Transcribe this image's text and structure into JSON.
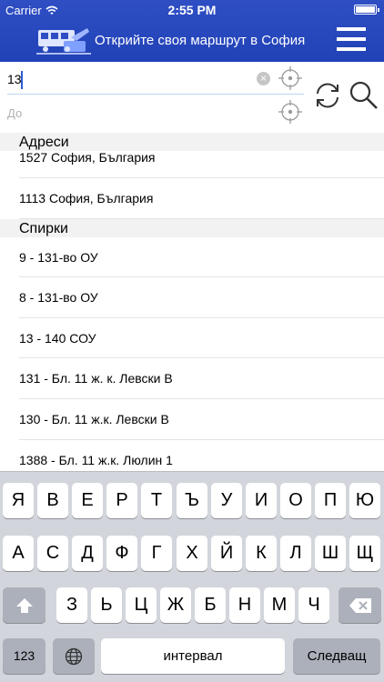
{
  "status_bar": {
    "carrier": "Carrier",
    "time": "2:55 PM"
  },
  "header": {
    "title": "Открийте своя маршрут в София"
  },
  "search": {
    "from_value": "13",
    "to_placeholder": "До"
  },
  "sections": [
    {
      "title": "Адреси",
      "items": [
        "1527 София, България",
        "1113 София, България"
      ]
    },
    {
      "title": "Спирки",
      "items": [
        "9 - 131-во ОУ",
        "8 - 131-во ОУ",
        "13 - 140 СОУ",
        "131 - Бл. 11 ж. к. Левски В",
        "130 - Бл. 11 ж.к. Левски В",
        "1388 - Бл. 11 ж.к. Люлин 1"
      ]
    }
  ],
  "keyboard": {
    "row1": [
      "Я",
      "В",
      "Е",
      "Р",
      "Т",
      "Ъ",
      "У",
      "И",
      "О",
      "П",
      "Ю"
    ],
    "row2": [
      "А",
      "С",
      "Д",
      "Ф",
      "Г",
      "Х",
      "Й",
      "К",
      "Л",
      "Ш",
      "Щ"
    ],
    "row3": [
      "З",
      "Ь",
      "Ц",
      "Ж",
      "Б",
      "Н",
      "М",
      "Ч"
    ],
    "numbers_label": "123",
    "space_label": "интервал",
    "return_label": "Следващ"
  },
  "colors": {
    "header": "#2142b7",
    "accent": "#2b5cd6"
  }
}
